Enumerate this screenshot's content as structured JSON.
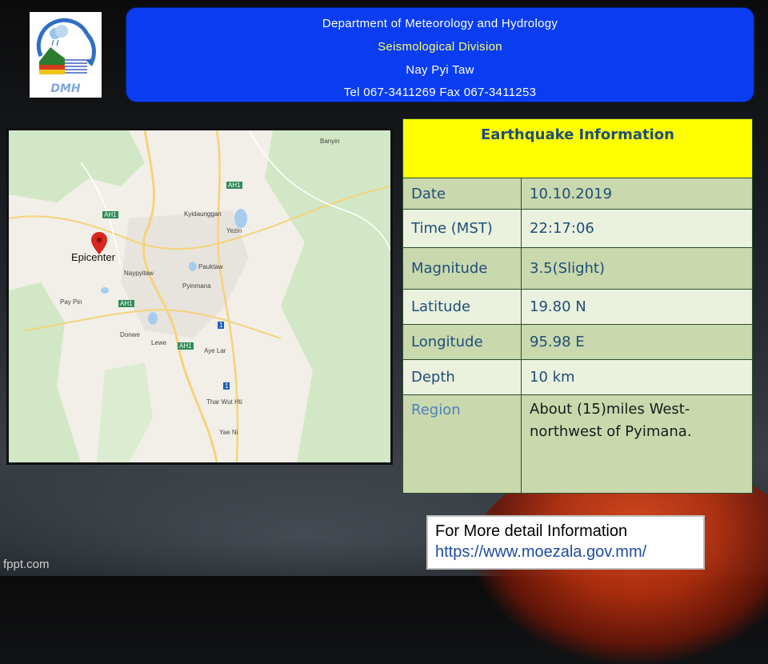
{
  "header": {
    "line1": "Department of Meteorology and Hydrology",
    "line2": "Seismological Division",
    "line3": "Nay Pyi Taw",
    "line4": "Tel 067-3411269 Fax 067-3411253"
  },
  "logo": {
    "text": "DMH"
  },
  "map": {
    "epicenter_label": "Epicenter",
    "place_labels": [
      "Banyin",
      "Kyidaunggan",
      "Yezin",
      "Naypyitaw",
      "Pyinmana",
      "Pauktaw",
      "Pay Pin",
      "Donwe",
      "Lewe",
      "Aye Lar",
      "Thar Wut Hti",
      "Yae Ni",
      "AH1",
      "AH1",
      "AH1",
      "AH1",
      "1",
      "1"
    ],
    "colors": {
      "land": "#f1efe8",
      "forest": "#d2e7c5",
      "urban": "#e7e4de",
      "road": "#f6d37a",
      "water": "#a7cdee",
      "pin": "#d9281e"
    }
  },
  "info": {
    "title": "Earthquake Information",
    "rows": [
      {
        "label": "Date",
        "value": "10.10.2019"
      },
      {
        "label": "Time (MST)",
        "value": "22:17:06"
      },
      {
        "label": "Magnitude",
        "value": "3.5(Slight)"
      },
      {
        "label": "Latitude",
        "value": "19.80 N"
      },
      {
        "label": "Longitude",
        "value": "95.98 E"
      },
      {
        "label": "Depth",
        "value": "10 km"
      },
      {
        "label": "Region",
        "value": "About (15)miles  West-northwest of Pyimana."
      }
    ]
  },
  "more": {
    "line1": "For More detail Information",
    "link": "https://www.moezala.gov.mm/"
  },
  "brand": "fppt.com",
  "colors": {
    "header_bg": "#0a3df2",
    "title_bg": "#ffff00",
    "row_dark": "#c9d8ad",
    "row_light": "#eaf1dd",
    "label_text": "#1f4e79"
  }
}
